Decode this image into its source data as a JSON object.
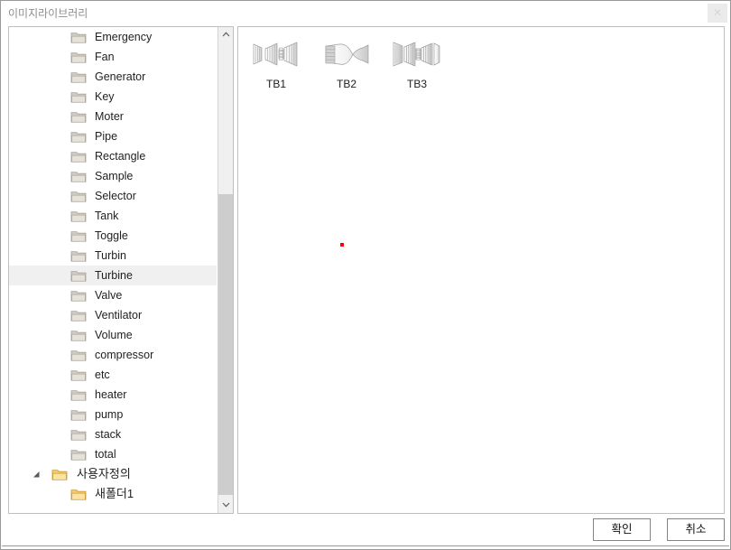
{
  "window": {
    "title": "이미지라이브러리",
    "close_label": "✕"
  },
  "tree": {
    "scrollbar": {
      "up_arrow": "scroll-up-arrow-icon",
      "down_arrow": "scroll-down-arrow-icon"
    },
    "items": [
      {
        "label": "Emergency",
        "level": 1,
        "selected": false,
        "icon": "folder-gray-icon",
        "expander": "none"
      },
      {
        "label": "Fan",
        "level": 1,
        "selected": false,
        "icon": "folder-gray-icon",
        "expander": "none"
      },
      {
        "label": "Generator",
        "level": 1,
        "selected": false,
        "icon": "folder-gray-icon",
        "expander": "none"
      },
      {
        "label": "Key",
        "level": 1,
        "selected": false,
        "icon": "folder-gray-icon",
        "expander": "none"
      },
      {
        "label": "Moter",
        "level": 1,
        "selected": false,
        "icon": "folder-gray-icon",
        "expander": "none"
      },
      {
        "label": "Pipe",
        "level": 1,
        "selected": false,
        "icon": "folder-gray-icon",
        "expander": "none"
      },
      {
        "label": "Rectangle",
        "level": 1,
        "selected": false,
        "icon": "folder-gray-icon",
        "expander": "none"
      },
      {
        "label": "Sample",
        "level": 1,
        "selected": false,
        "icon": "folder-gray-icon",
        "expander": "none"
      },
      {
        "label": "Selector",
        "level": 1,
        "selected": false,
        "icon": "folder-gray-icon",
        "expander": "none"
      },
      {
        "label": "Tank",
        "level": 1,
        "selected": false,
        "icon": "folder-gray-icon",
        "expander": "none"
      },
      {
        "label": "Toggle",
        "level": 1,
        "selected": false,
        "icon": "folder-gray-icon",
        "expander": "none"
      },
      {
        "label": "Turbin",
        "level": 1,
        "selected": false,
        "icon": "folder-gray-icon",
        "expander": "none"
      },
      {
        "label": "Turbine",
        "level": 1,
        "selected": true,
        "icon": "folder-gray-icon",
        "expander": "none"
      },
      {
        "label": "Valve",
        "level": 1,
        "selected": false,
        "icon": "folder-gray-icon",
        "expander": "none"
      },
      {
        "label": "Ventilator",
        "level": 1,
        "selected": false,
        "icon": "folder-gray-icon",
        "expander": "none"
      },
      {
        "label": "Volume",
        "level": 1,
        "selected": false,
        "icon": "folder-gray-icon",
        "expander": "none"
      },
      {
        "label": "compressor",
        "level": 1,
        "selected": false,
        "icon": "folder-gray-icon",
        "expander": "none"
      },
      {
        "label": "etc",
        "level": 1,
        "selected": false,
        "icon": "folder-gray-icon",
        "expander": "none"
      },
      {
        "label": "heater",
        "level": 1,
        "selected": false,
        "icon": "folder-gray-icon",
        "expander": "none"
      },
      {
        "label": "pump",
        "level": 1,
        "selected": false,
        "icon": "folder-gray-icon",
        "expander": "none"
      },
      {
        "label": "stack",
        "level": 1,
        "selected": false,
        "icon": "folder-gray-icon",
        "expander": "none"
      },
      {
        "label": "total",
        "level": 1,
        "selected": false,
        "icon": "folder-gray-icon",
        "expander": "none"
      },
      {
        "label": "사용자정의",
        "level": 0,
        "selected": false,
        "icon": "folder-yellow-icon",
        "expander": "expanded"
      },
      {
        "label": "새폴더1",
        "level": 1,
        "selected": false,
        "icon": "folder-yellow-icon",
        "expander": "none"
      }
    ]
  },
  "content": {
    "thumbnails": [
      {
        "caption": "TB1",
        "icon": "turbine-bladed-icon"
      },
      {
        "caption": "TB2",
        "icon": "turbine-nozzle-icon"
      },
      {
        "caption": "TB3",
        "icon": "turbine-multistage-icon"
      }
    ],
    "marker": {
      "name": "red-dot-marker",
      "color": "#fe0000"
    }
  },
  "footer": {
    "ok_label": "확인",
    "cancel_label": "취소"
  }
}
